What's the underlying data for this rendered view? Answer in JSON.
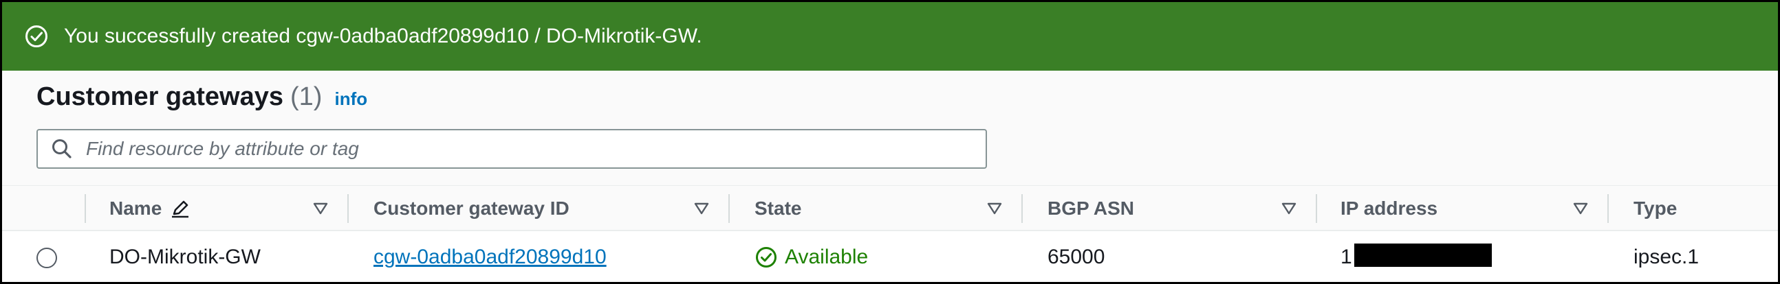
{
  "colors": {
    "banner_background": "#3a7f26",
    "link": "#0073bb",
    "status_available": "#1d8102"
  },
  "banner": {
    "icon": "check-circle-icon",
    "message": "You successfully created cgw-0adba0adf20899d10 / DO-Mikrotik-GW."
  },
  "header": {
    "title": "Customer gateways",
    "count": "(1)",
    "info_link": "info"
  },
  "search": {
    "icon": "search-icon",
    "placeholder": "Find resource by attribute or tag",
    "value": ""
  },
  "table": {
    "columns": [
      {
        "label": "Name",
        "editable_icon": "pencil-icon",
        "sortable": true
      },
      {
        "label": "Customer gateway ID",
        "sortable": true
      },
      {
        "label": "State",
        "sortable": true
      },
      {
        "label": "BGP ASN",
        "sortable": true
      },
      {
        "label": "IP address",
        "sortable": true
      },
      {
        "label": "Type",
        "sortable": false
      }
    ],
    "rows": [
      {
        "selected": false,
        "name": "DO-Mikrotik-GW",
        "customer_gateway_id": "cgw-0adba0adf20899d10",
        "state": "Available",
        "state_icon": "check-circle-icon",
        "bgp_asn": "65000",
        "ip_address_visible": "1",
        "ip_address_redacted": true,
        "type": "ipsec.1"
      }
    ]
  }
}
